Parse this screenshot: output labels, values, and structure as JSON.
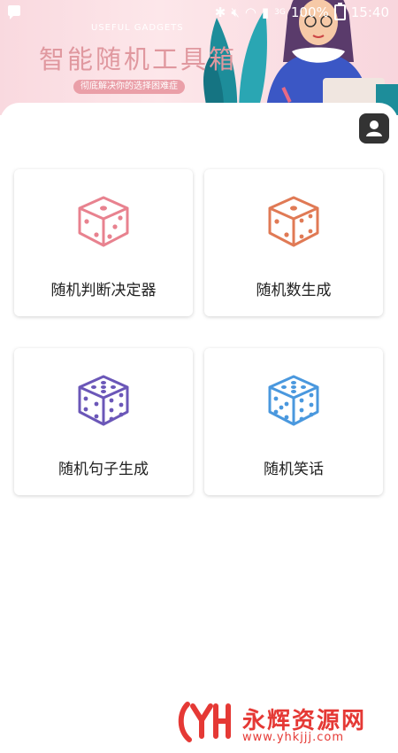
{
  "status_bar": {
    "network": "3G",
    "battery": "100%",
    "time": "15:40"
  },
  "banner": {
    "subtitle_en": "USEFUL GADGETS",
    "title": "智能随机工具箱",
    "slogan": "彻底解决你的选择困难症"
  },
  "tools": [
    {
      "label": "随机判断决定器",
      "color": "#e8828f",
      "icon": "pink-dice-icon"
    },
    {
      "label": "随机数生成",
      "color": "#e07a55",
      "icon": "orange-dice-icon"
    },
    {
      "label": "随机句子生成",
      "color": "#6b57b8",
      "icon": "purple-dice-icon"
    },
    {
      "label": "随机笑话",
      "color": "#4a98de",
      "icon": "blue-dice-icon"
    }
  ],
  "profile_button_icon": "user-icon",
  "watermark": {
    "brand": "永辉资源网",
    "url": "www.yhkjjj.com",
    "color": "#e53935"
  }
}
